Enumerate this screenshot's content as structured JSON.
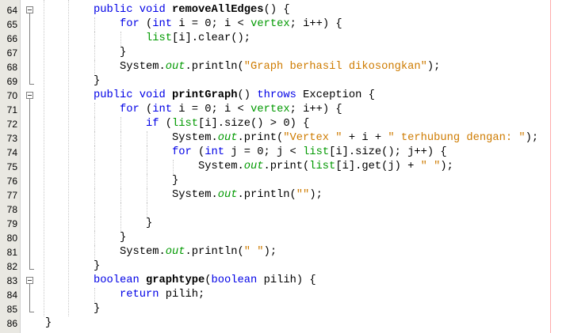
{
  "editor": {
    "margin_color": "#ffaaaa",
    "colors": {
      "keyword": "#0000e6",
      "field": "#009900",
      "string": "#ce7b00"
    },
    "lines": [
      {
        "n": "64",
        "indent": 1,
        "fold": "start",
        "tokens": [
          [
            "public void ",
            "k"
          ],
          [
            "removeAllEdges",
            "m"
          ],
          [
            "() {",
            "p"
          ]
        ]
      },
      {
        "n": "65",
        "indent": 2,
        "tokens": [
          [
            "for",
            "k"
          ],
          [
            " (",
            "p"
          ],
          [
            "int",
            "k"
          ],
          [
            " i = 0; i < ",
            "p"
          ],
          [
            "vertex",
            "f"
          ],
          [
            "; i++) {",
            "p"
          ]
        ]
      },
      {
        "n": "66",
        "indent": 3,
        "tokens": [
          [
            "list",
            "f"
          ],
          [
            "[i].clear();",
            "p"
          ]
        ]
      },
      {
        "n": "67",
        "indent": 2,
        "tokens": [
          [
            "}",
            "p"
          ]
        ]
      },
      {
        "n": "68",
        "indent": 2,
        "tokens": [
          [
            "System.",
            "p"
          ],
          [
            "out",
            "o"
          ],
          [
            ".println(",
            "p"
          ],
          [
            "\"Graph berhasil dikosongkan\"",
            "s"
          ],
          [
            ");",
            "p"
          ]
        ]
      },
      {
        "n": "69",
        "indent": 1,
        "fold": "end",
        "tokens": [
          [
            "}",
            "p"
          ]
        ]
      },
      {
        "n": "70",
        "indent": 1,
        "fold": "start",
        "tokens": [
          [
            "public void ",
            "k"
          ],
          [
            "printGraph",
            "m"
          ],
          [
            "() ",
            "p"
          ],
          [
            "throws",
            "k"
          ],
          [
            " Exception {",
            "p"
          ]
        ]
      },
      {
        "n": "71",
        "indent": 2,
        "tokens": [
          [
            "for",
            "k"
          ],
          [
            " (",
            "p"
          ],
          [
            "int",
            "k"
          ],
          [
            " i = 0; i < ",
            "p"
          ],
          [
            "vertex",
            "f"
          ],
          [
            "; i++) {",
            "p"
          ]
        ]
      },
      {
        "n": "72",
        "indent": 3,
        "tokens": [
          [
            "if",
            "k"
          ],
          [
            " (",
            "p"
          ],
          [
            "list",
            "f"
          ],
          [
            "[i].size() > 0) {",
            "p"
          ]
        ]
      },
      {
        "n": "73",
        "indent": 4,
        "tokens": [
          [
            "System.",
            "p"
          ],
          [
            "out",
            "o"
          ],
          [
            ".print(",
            "p"
          ],
          [
            "\"Vertex \"",
            "s"
          ],
          [
            " + i + ",
            "p"
          ],
          [
            "\" terhubung dengan: \"",
            "s"
          ],
          [
            ");",
            "p"
          ]
        ]
      },
      {
        "n": "74",
        "indent": 4,
        "tokens": [
          [
            "for",
            "k"
          ],
          [
            " (",
            "p"
          ],
          [
            "int",
            "k"
          ],
          [
            " j = 0; j < ",
            "p"
          ],
          [
            "list",
            "f"
          ],
          [
            "[i].size(); j++) {",
            "p"
          ]
        ]
      },
      {
        "n": "75",
        "indent": 5,
        "tokens": [
          [
            "System.",
            "p"
          ],
          [
            "out",
            "o"
          ],
          [
            ".print(",
            "p"
          ],
          [
            "list",
            "f"
          ],
          [
            "[i].get(j) + ",
            "p"
          ],
          [
            "\" \"",
            "s"
          ],
          [
            ");",
            "p"
          ]
        ]
      },
      {
        "n": "76",
        "indent": 4,
        "tokens": [
          [
            "}",
            "p"
          ]
        ]
      },
      {
        "n": "77",
        "indent": 4,
        "tokens": [
          [
            "System.",
            "p"
          ],
          [
            "out",
            "o"
          ],
          [
            ".println(",
            "p"
          ],
          [
            "\"\"",
            "s"
          ],
          [
            ");",
            "p"
          ]
        ]
      },
      {
        "n": "78",
        "indent": 4,
        "tokens": []
      },
      {
        "n": "79",
        "indent": 3,
        "tokens": [
          [
            "}",
            "p"
          ]
        ]
      },
      {
        "n": "80",
        "indent": 2,
        "tokens": [
          [
            "}",
            "p"
          ]
        ]
      },
      {
        "n": "81",
        "indent": 2,
        "tokens": [
          [
            "System.",
            "p"
          ],
          [
            "out",
            "o"
          ],
          [
            ".println(",
            "p"
          ],
          [
            "\" \"",
            "s"
          ],
          [
            ");",
            "p"
          ]
        ]
      },
      {
        "n": "82",
        "indent": 1,
        "fold": "end",
        "tokens": [
          [
            "}",
            "p"
          ]
        ]
      },
      {
        "n": "83",
        "indent": 1,
        "fold": "start",
        "tokens": [
          [
            "boolean ",
            "k"
          ],
          [
            "graphtype",
            "m"
          ],
          [
            "(",
            "p"
          ],
          [
            "boolean",
            "k"
          ],
          [
            " pilih) {",
            "p"
          ]
        ]
      },
      {
        "n": "84",
        "indent": 2,
        "tokens": [
          [
            "return",
            "k"
          ],
          [
            " pilih;",
            "p"
          ]
        ]
      },
      {
        "n": "85",
        "indent": 1,
        "fold": "end",
        "tokens": [
          [
            "}",
            "p"
          ]
        ]
      },
      {
        "n": "86",
        "indent": 0,
        "tokens": [
          [
            "}",
            "p"
          ]
        ]
      }
    ]
  }
}
